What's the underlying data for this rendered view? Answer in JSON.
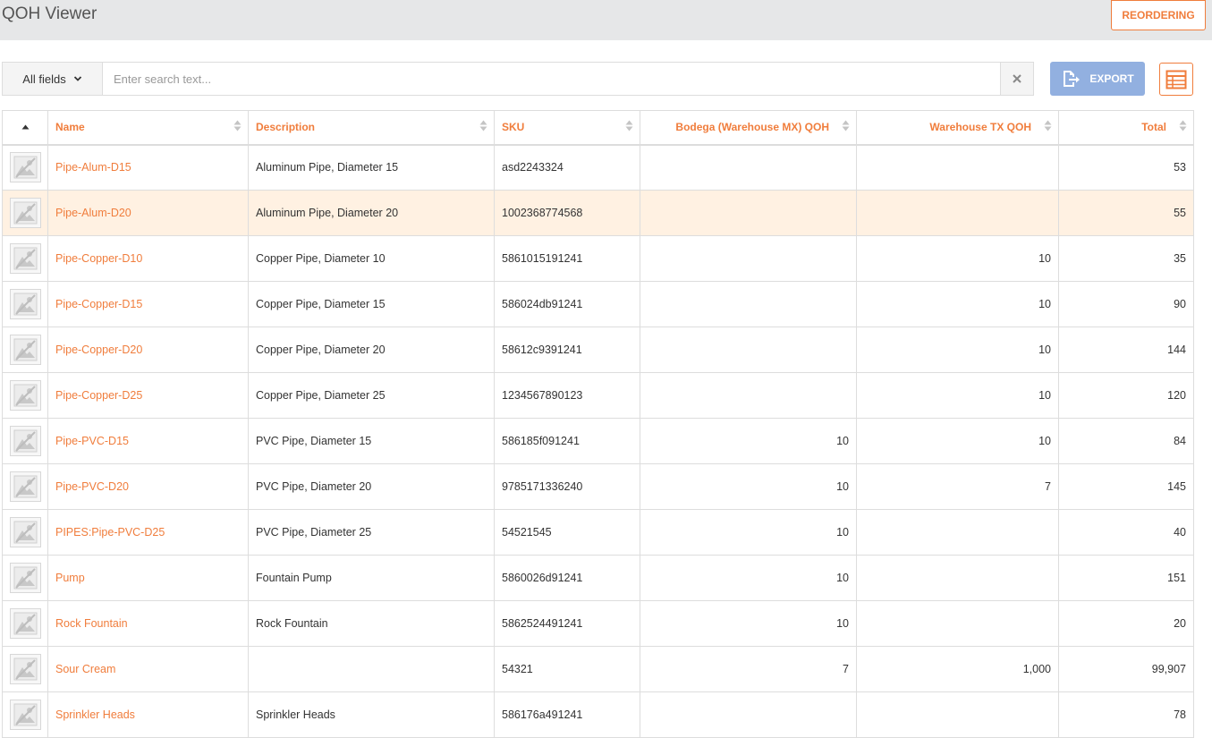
{
  "app": {
    "title": "QOH Viewer"
  },
  "header": {
    "reorder_label": "REORDERING"
  },
  "search": {
    "field_label": "All fields",
    "placeholder": "Enter search text...",
    "value": ""
  },
  "toolbar": {
    "export_label": "EXPORT",
    "columns_icon": "table-columns-icon"
  },
  "colors": {
    "accent": "#f07d3c",
    "export_bg": "#92b0e0",
    "highlight_row": "#fff1e2",
    "topbar_bg": "#e6e7e8"
  },
  "table": {
    "columns": {
      "name": "Name",
      "description": "Description",
      "sku": "SKU",
      "mx_qoh": "Bodega (Warehouse MX) QOH",
      "tx_qoh": "Warehouse TX QOH",
      "total": "Total"
    },
    "sort": {
      "column": "thumbnail",
      "direction": "asc"
    },
    "rows": [
      {
        "name": "Pipe-Alum-D15",
        "description": "Aluminum Pipe, Diameter 15",
        "sku": "asd2243324",
        "mx": "",
        "tx": "",
        "total": "53",
        "highlighted": false
      },
      {
        "name": "Pipe-Alum-D20",
        "description": "Aluminum Pipe, Diameter 20",
        "sku": "1002368774568",
        "mx": "",
        "tx": "",
        "total": "55",
        "highlighted": true
      },
      {
        "name": "Pipe-Copper-D10",
        "description": "Copper Pipe, Diameter 10",
        "sku": "5861015191241",
        "mx": "",
        "tx": "10",
        "total": "35",
        "highlighted": false
      },
      {
        "name": "Pipe-Copper-D15",
        "description": "Copper Pipe, Diameter 15",
        "sku": "586024db91241",
        "mx": "",
        "tx": "10",
        "total": "90",
        "highlighted": false
      },
      {
        "name": "Pipe-Copper-D20",
        "description": "Copper Pipe, Diameter 20",
        "sku": "58612c9391241",
        "mx": "",
        "tx": "10",
        "total": "144",
        "highlighted": false
      },
      {
        "name": "Pipe-Copper-D25",
        "description": "Copper Pipe, Diameter 25",
        "sku": "1234567890123",
        "mx": "",
        "tx": "10",
        "total": "120",
        "highlighted": false
      },
      {
        "name": "Pipe-PVC-D15",
        "description": "PVC Pipe, Diameter 15",
        "sku": "586185f091241",
        "mx": "10",
        "tx": "10",
        "total": "84",
        "highlighted": false
      },
      {
        "name": "Pipe-PVC-D20",
        "description": "PVC Pipe, Diameter 20",
        "sku": "9785171336240",
        "mx": "10",
        "tx": "7",
        "total": "145",
        "highlighted": false
      },
      {
        "name": "PIPES:Pipe-PVC-D25",
        "description": "PVC Pipe, Diameter 25",
        "sku": "54521545",
        "mx": "10",
        "tx": "",
        "total": "40",
        "highlighted": false
      },
      {
        "name": "Pump",
        "description": "Fountain Pump",
        "sku": "5860026d91241",
        "mx": "10",
        "tx": "",
        "total": "151",
        "highlighted": false
      },
      {
        "name": "Rock Fountain",
        "description": "Rock Fountain",
        "sku": "5862524491241",
        "mx": "10",
        "tx": "",
        "total": "20",
        "highlighted": false
      },
      {
        "name": "Sour Cream",
        "description": "",
        "sku": "54321",
        "mx": "7",
        "tx": "1,000",
        "total": "99,907",
        "highlighted": false
      },
      {
        "name": "Sprinkler Heads",
        "description": "Sprinkler Heads",
        "sku": "586176a491241",
        "mx": "",
        "tx": "",
        "total": "78",
        "highlighted": false
      }
    ]
  }
}
